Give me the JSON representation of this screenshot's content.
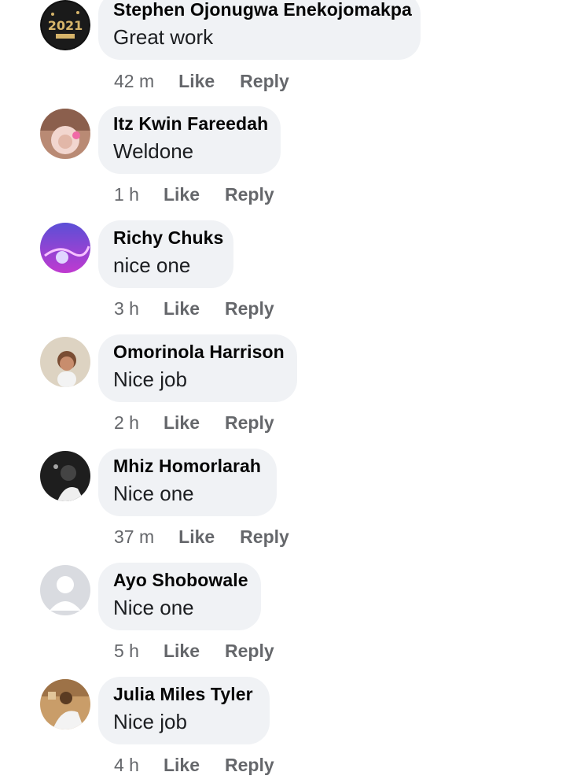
{
  "actions": {
    "like_label": "Like",
    "reply_label": "Reply"
  },
  "comments": [
    {
      "author": "Stephen Ojonugwa Enekojomakpa",
      "text": "Great work",
      "time": "42 m",
      "avatar": "avatar-2021-icon"
    },
    {
      "author": "Itz Kwin Fareedah",
      "text": "Weldone",
      "time": "1 h",
      "avatar": "avatar-photo"
    },
    {
      "author": "Richy Chuks",
      "text": "nice one",
      "time": "3 h",
      "avatar": "avatar-photo"
    },
    {
      "author": "Omorinola Harrison",
      "text": "Nice job",
      "time": "2 h",
      "avatar": "avatar-photo"
    },
    {
      "author": "Mhiz Homorlarah",
      "text": "Nice one",
      "time": "37 m",
      "avatar": "avatar-photo"
    },
    {
      "author": "Ayo Shobowale",
      "text": "Nice one",
      "time": "5 h",
      "avatar": "default-avatar-icon"
    },
    {
      "author": "Julia Miles Tyler",
      "text": "Nice job",
      "time": "4 h",
      "avatar": "avatar-photo"
    }
  ],
  "colors": {
    "bubble": "#f0f2f5",
    "meta_text": "#65676b",
    "name_text": "#050505"
  }
}
